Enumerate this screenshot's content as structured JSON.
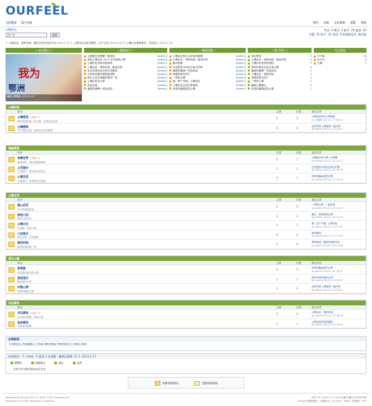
{
  "header": {
    "logo": "OURFEEL",
    "login": "立即登录",
    "register": "用户注册",
    "top_links": [
      "首页",
      "导航",
      "论坛帮助",
      "搜索",
      "帮助"
    ]
  },
  "breadcrumb": "心情论坛",
  "search": {
    "placeholder": "用户名",
    "button": "搜索"
  },
  "stats": {
    "line1": "今日: 3  昨日: 3  帖子: 20  会员: 20",
    "line2": "主题: 35  帖子: 42  会员: 8  欢迎新会员: 新员账"
  },
  "notice": "1. 心情论坛，倾听你我，建设开放交流的平台 2013-1-17   2. 心情论坛对会员要求，乐于交流 2013-1-10   3. 心情论坛是新版本，欢迎加入 2013-1-10",
  "columns": {
    "pic": "» 论坛图片 »",
    "new": "» 最新帖子 »",
    "hot": "» 最新回复 »",
    "rank": "» 热门排行 »",
    "today": "今日发帖"
  },
  "slide": {
    "top": "我为",
    "bottom": "鄂洲",
    "caption": "最新心情图片 2013-1-17"
  },
  "new_posts": [
    {
      "t": "大数据分析需要一套体系",
      "by": "[admin]"
    },
    {
      "t": "我在心情论坛 2013 年开始的心情",
      "by": "[admin]"
    },
    {
      "t": "心情论坛专用试验帖吧",
      "by": "[admin]"
    },
    {
      "t": "心情论坛：倾听你我，建设开放",
      "by": "[admin]"
    },
    {
      "t": "站长说明论坛分享交流规则",
      "by": "[admin]"
    },
    {
      "t": "今年秋天要去哪里旅游呢",
      "by": "[admin]"
    },
    {
      "t": "那什么论坛有趣的事说一说",
      "by": "[admin]"
    },
    {
      "t": "心情论坛怎么样",
      "by": "[admin]"
    },
    {
      "t": "欢迎光临",
      "by": "[admin]"
    },
    {
      "t": "最新的事情一句话说说",
      "by": "[admin]"
    }
  ],
  "hot_posts": [
    {
      "t": "心情论坛有什么好玩的事情",
      "by": "[admin]"
    },
    {
      "t": "心情论坛：倾听你我，建设开放",
      "by": "[admin]"
    },
    {
      "t": "最大限度",
      "by": "[admin]"
    },
    {
      "t": "在这里说今年的计划与打算",
      "by": "[admin]"
    },
    {
      "t": "最新的事情一句话说说",
      "by": "[admin]"
    },
    {
      "t": "我想学新东西了",
      "by": "[admin]"
    },
    {
      "t": "一样的心情",
      "by": "[admin]"
    },
    {
      "t": "哦，是个不错，心情论坛",
      "by": "[admin]"
    },
    {
      "t": "心情论坛交流分享规则",
      "by": "[admin]"
    },
    {
      "t": "说说你最喜欢的心情",
      "by": "[admin]"
    }
  ],
  "rank_posts": [
    {
      "t": "我为鄂洲",
      "n": "3"
    },
    {
      "t": "心情论坛：倾听你我，建设开放",
      "n": "4"
    },
    {
      "t": "心情论坛有关的规则",
      "n": "3"
    },
    {
      "t": "倾听你我在论坛交流心情",
      "n": "3"
    },
    {
      "t": "最新的事情一句话说说",
      "n": "2"
    },
    {
      "t": "心情论坛：倾听你我",
      "n": "2"
    },
    {
      "t": "我想学新东西了",
      "n": "2"
    },
    {
      "t": "一样的心情",
      "n": "2"
    },
    {
      "t": "最新心情图片",
      "n": "2"
    },
    {
      "t": "说说你最喜欢的心情",
      "n": "1"
    }
  ],
  "today": [
    {
      "t": "天下事",
      "n": "10"
    },
    {
      "t": "admin",
      "n": "8"
    },
    {
      "t": "心情",
      "n": "2"
    }
  ],
  "sections": [
    {
      "title": "心情时间",
      "head": {
        "f": "版块",
        "t": "主题",
        "p": "帖数",
        "l": "最后发表"
      },
      "rows": [
        {
          "name": "心情签到",
          "new": "(今日: 1)",
          "desc": "倾听你我的每一天心情，记录生活点滴",
          "t": "2",
          "p": "3",
          "l1": "心情论坛有什么好玩的",
          "l2": "by 天使粉 2013-1-17 08:15"
        },
        {
          "name": "心情随笔",
          "new": "",
          "desc": "写下你的心情，说说生活中的事情",
          "t": "2",
          "p": "2",
          "l1": "百花齐放 心情我们一起分享",
          "l2": "by admin 2013-1-10 10:47"
        }
      ]
    },
    {
      "title": "情感家园",
      "head": {
        "f": "版块",
        "t": "主题",
        "p": "帖数",
        "l": "最后发表"
      },
      "rows": [
        {
          "name": "亲情世界",
          "new": "(今日: 1)",
          "desc": "亲情世界，我们的家的故事",
          "t": "2",
          "p": "1",
          "l1": "小编给大家心情一点感谢",
          "l2": "by admin 2013-1-10 11:17"
        },
        {
          "name": "心灵独白",
          "new": "",
          "desc": "心灵独白，面对自己的内心",
          "t": "1",
          "p": "2",
          "l1": "在这里说今年的计划与打算",
          "l2": "by admin 2013-1-10 10:25"
        },
        {
          "name": "心事百货",
          "new": "",
          "desc": "心事百货，说说你的心里话",
          "t": "1",
          "p": "1",
          "l1": "说说你最喜欢的心情",
          "l2": "by admin 2013-1-10 10:23"
        }
      ]
    },
    {
      "title": "心情文字",
      "head": {
        "f": "版块",
        "t": "主题",
        "p": "帖数",
        "l": "最后发表"
      },
      "rows": [
        {
          "name": "随心所写",
          "new": "",
          "desc": "写下你想说的话",
          "t": "2",
          "p": "2",
          "l1": "一样的心情，一起交流",
          "l2": "by admin 2013-1-10 10:17"
        },
        {
          "name": "原创小说",
          "new": "",
          "desc": "原创小说交流",
          "t": "1",
          "p": "1",
          "l1": "最大，说说你的心情",
          "l2": "by admin 2013-1-10 10:14"
        },
        {
          "name": "心情日记",
          "new": "",
          "desc": "记录每一天的心情",
          "t": "1",
          "p": "1",
          "l1": "哦，这个不错，心情论坛",
          "l2": "by admin 2013-1-10 10:07"
        },
        {
          "name": "小说美文",
          "new": "",
          "desc": "美文分享，好文推荐",
          "t": "2",
          "p": "2",
          "l1": "我为鄂洲",
          "l2": "by admin 2013-1-10 10:05"
        },
        {
          "name": "感动时刻",
          "new": "",
          "desc": "感动你我的那一刻",
          "t": "3",
          "p": "3",
          "l1": "倾听你我，建设开放的平台",
          "l2": "by admin 2013-1-10 10:48"
        }
      ]
    },
    {
      "title": "音乐心情",
      "head": {
        "f": "版块",
        "t": "主题",
        "p": "帖数",
        "l": "最后发表"
      },
      "rows": [
        {
          "name": "那首歌",
          "new": "",
          "desc": "音乐陪伴我们的心情",
          "t": "1",
          "p": "1",
          "l1": "说说你最喜欢的心情",
          "l2": "by admin 2013-1-10 02:47"
        },
        {
          "name": "原创音乐",
          "new": "",
          "desc": "原创音乐分享",
          "t": "1",
          "p": "1",
          "l1": "说说今年的音乐计划",
          "l2": "by admin 2013-1-10 02:51"
        },
        {
          "name": "听歌心得",
          "new": "",
          "desc": "听歌时候的心得",
          "t": "2",
          "p": "3",
          "l1": "百花齐放 心情我们一起分享",
          "l2": "by admin 2013-1-10 10:47"
        }
      ]
    },
    {
      "title": "论坛事务",
      "head": {
        "f": "版块",
        "t": "主题",
        "p": "帖数",
        "l": "最后发表"
      },
      "rows": [
        {
          "name": "论坛事务",
          "new": "(今日: 1)",
          "desc": "论坛事务管理，站务公告",
          "t": "2",
          "p": "3",
          "l1": "心情论坛：倾听你我",
          "l2": "by admin 2013-1-17 08:43"
        },
        {
          "name": "站务事务",
          "new": "",
          "desc": "站务事务处理",
          "t": "1",
          "p": "1",
          "l1": "心情论坛有关的规则",
          "l2": "by admin 2013-1-10 09:54"
        }
      ]
    }
  ],
  "links": {
    "title": "友情链接",
    "text": "[心情论坛] [传智播客] [江苏省心情志愿者] [神农架论坛] [中国心灵网]"
  },
  "online": {
    "title": "在线会员 - 1 人在线 - 0 会员 1 位游客 - 最高记录是 12 于 2013-1-17",
    "legend": [
      "管理员",
      "超级版主",
      "版主",
      "会员"
    ],
    "note": "当前只有游客或隐身会员在线"
  },
  "legend_box": {
    "a": "有新帖的版块",
    "b": "无新帖的版块"
  },
  "footer": {
    "l1": "Powered by Discuz! X2.5 © 2001-2012 Comsenz Inc.",
    "l2": "Processed in 0.097 second(s), 6 queries.",
    "r1": "GMT+8, 2013-1-17 10:50  豫ICP备12345678号",
    "r2": "Contact 联系我们 · 心情论坛 · Archiver · WAP · 手机版 · TOP"
  }
}
